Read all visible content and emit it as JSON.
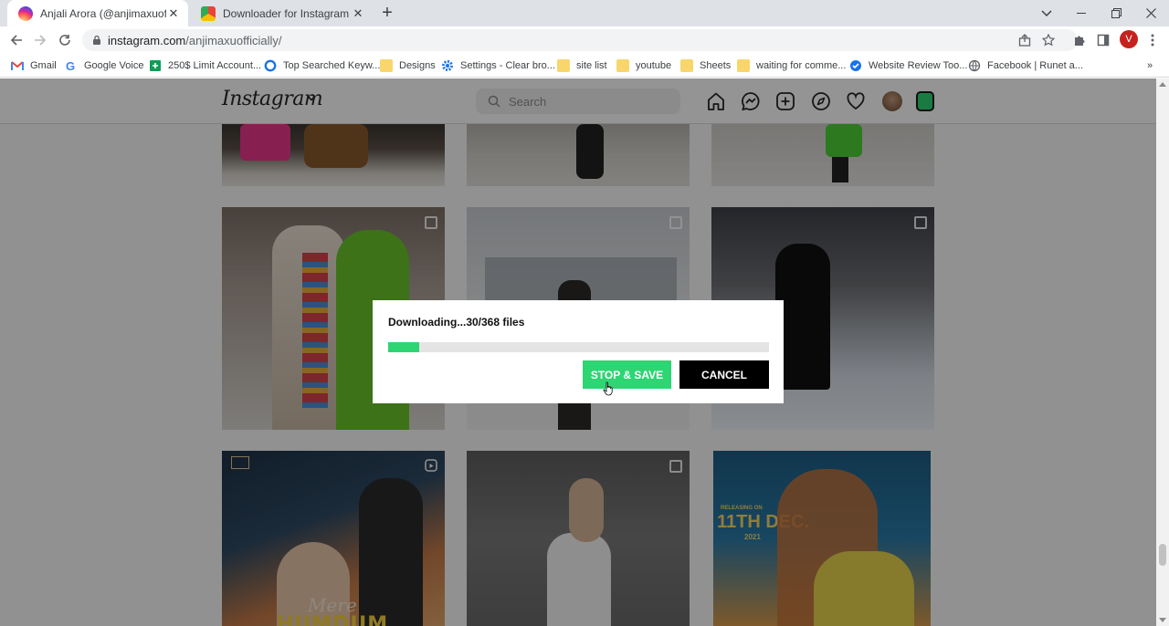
{
  "browser": {
    "tabs": [
      {
        "title": "Anjali Arora (@anjimaxuofficially",
        "active": true,
        "favicon": "instagram-icon"
      },
      {
        "title": "Downloader for Instagram - Chro",
        "active": false,
        "favicon": "chrome-webstore-icon"
      }
    ],
    "url_host": "instagram.com",
    "url_path": "/anjimaxuofficially/",
    "profile_initial": "V",
    "bookmarks": [
      {
        "label": "Gmail",
        "icon": "gmail-icon"
      },
      {
        "label": "Google Voice",
        "icon": "google-icon"
      },
      {
        "label": "250$ Limit Account...",
        "icon": "sheets-icon"
      },
      {
        "label": "Top Searched Keyw...",
        "icon": "circle-icon"
      },
      {
        "label": "Designs",
        "icon": "folder-icon"
      },
      {
        "label": "Settings - Clear bro...",
        "icon": "gear-icon"
      },
      {
        "label": "site list",
        "icon": "folder-icon"
      },
      {
        "label": "youtube",
        "icon": "folder-icon"
      },
      {
        "label": "Sheets",
        "icon": "folder-icon"
      },
      {
        "label": "waiting for comme...",
        "icon": "folder-icon"
      },
      {
        "label": "Website Review Too...",
        "icon": "check-icon"
      },
      {
        "label": "Facebook | Runet a...",
        "icon": "globe-icon"
      }
    ],
    "more_bookmarks": "»"
  },
  "instagram": {
    "logo": "Instagram",
    "search_placeholder": "Search"
  },
  "dialog": {
    "status": "Downloading...30/368 files",
    "progress": 0.0815,
    "stop_save_label": "STOP & SAVE",
    "cancel_label": "CANCEL"
  },
  "posters": {
    "poster2_date_small": "RELEASING ON",
    "poster2_date": "11TH DEC.",
    "poster2_year": "2021",
    "poster1_title": "Mere",
    "poster1_title2": "HUMDUM"
  },
  "colors": {
    "accent_green": "#2ed573",
    "cancel_black": "#000000",
    "profile_red": "#c5221f"
  }
}
